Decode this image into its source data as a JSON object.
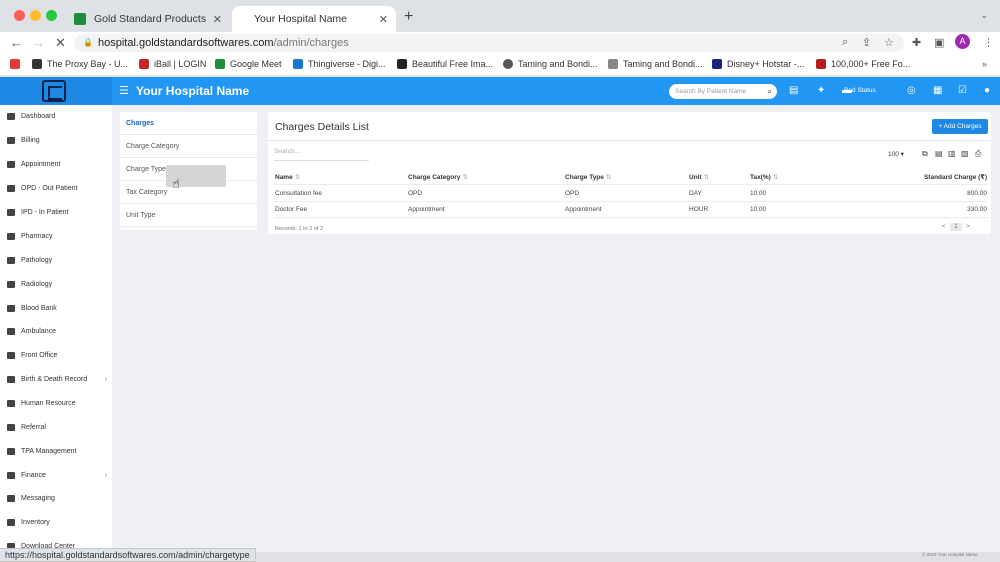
{
  "browser": {
    "tabs": [
      {
        "title": "Gold Standard Products - Goo"
      },
      {
        "title": "Your Hospital Name"
      }
    ],
    "new_tab_icon": "+",
    "tab_menu_icon": "⌄",
    "url_host": "hospital.goldstandardsoftwares.com",
    "url_path": "/admin/charges",
    "avatar_letter": "A",
    "bookmarks": [
      {
        "label": "",
        "color": "#e53935"
      },
      {
        "label": "The Proxy Bay - U...",
        "color": "#333333"
      },
      {
        "label": "iBall | LOGIN",
        "color": "#c62828"
      },
      {
        "label": "Google Meet",
        "color": "#1e8e3e"
      },
      {
        "label": "Thingiverse - Digi...",
        "color": "#1976d2"
      },
      {
        "label": "Beautiful Free Ima...",
        "color": "#222222"
      },
      {
        "label": "Taming and Bondi...",
        "color": "#555555"
      },
      {
        "label": "Taming and Bondi...",
        "color": "#888888"
      },
      {
        "label": "Disney+ Hotstar -...",
        "color": "#1a237e"
      },
      {
        "label": "100,000+ Free Fo...",
        "color": "#b71c1c"
      }
    ],
    "status_url": "https://hospital.goldstandardsoftwares.com/admin/chargetype"
  },
  "header": {
    "hospital_name": "Your Hospital Name",
    "search_placeholder": "Search By Patient Name",
    "bed_status": "Bed Status"
  },
  "sidebar": {
    "items": [
      {
        "label": "Dashboard",
        "has_arrow": false
      },
      {
        "label": "Billing",
        "has_arrow": false
      },
      {
        "label": "Appointment",
        "has_arrow": false
      },
      {
        "label": "OPD - Out Patient",
        "has_arrow": false
      },
      {
        "label": "IPD - In Patient",
        "has_arrow": false
      },
      {
        "label": "Pharmacy",
        "has_arrow": false
      },
      {
        "label": "Pathology",
        "has_arrow": false
      },
      {
        "label": "Radiology",
        "has_arrow": false
      },
      {
        "label": "Blood Bank",
        "has_arrow": false
      },
      {
        "label": "Ambulance",
        "has_arrow": false
      },
      {
        "label": "Front Office",
        "has_arrow": false
      },
      {
        "label": "Birth & Death Record",
        "has_arrow": true
      },
      {
        "label": "Human Resource",
        "has_arrow": false
      },
      {
        "label": "Referral",
        "has_arrow": false
      },
      {
        "label": "TPA Management",
        "has_arrow": false
      },
      {
        "label": "Finance",
        "has_arrow": true
      },
      {
        "label": "Messaging",
        "has_arrow": false
      },
      {
        "label": "Inventory",
        "has_arrow": false
      },
      {
        "label": "Download Center",
        "has_arrow": false
      }
    ]
  },
  "subnav": {
    "items": [
      {
        "label": "Charges",
        "active": true
      },
      {
        "label": "Charge Category",
        "active": false
      },
      {
        "label": "Charge Type",
        "active": false
      },
      {
        "label": "Tax Category",
        "active": false
      },
      {
        "label": "Unit Type",
        "active": false
      }
    ]
  },
  "charges": {
    "title": "Charges Details List",
    "add_button": "+ Add Charges",
    "search_placeholder": "Search...",
    "page_size": "100",
    "columns": [
      "Name",
      "Charge Category",
      "Charge Type",
      "Unit",
      "Tax(%)",
      "Standard Charge (₹)"
    ],
    "rows": [
      [
        "Consultation fee",
        "OPD",
        "OPD",
        "DAY",
        "10.00",
        "800.00"
      ],
      [
        "Doctor Fee",
        "Appointment",
        "Appointment",
        "HOUR",
        "10.00",
        "330.00"
      ]
    ],
    "records": "Records: 1 to 2 of 2",
    "pager": {
      "prev": "<",
      "current": "1",
      "next": ">"
    }
  },
  "footer": {
    "copyright": "© 2024 Your Hospital Name"
  }
}
